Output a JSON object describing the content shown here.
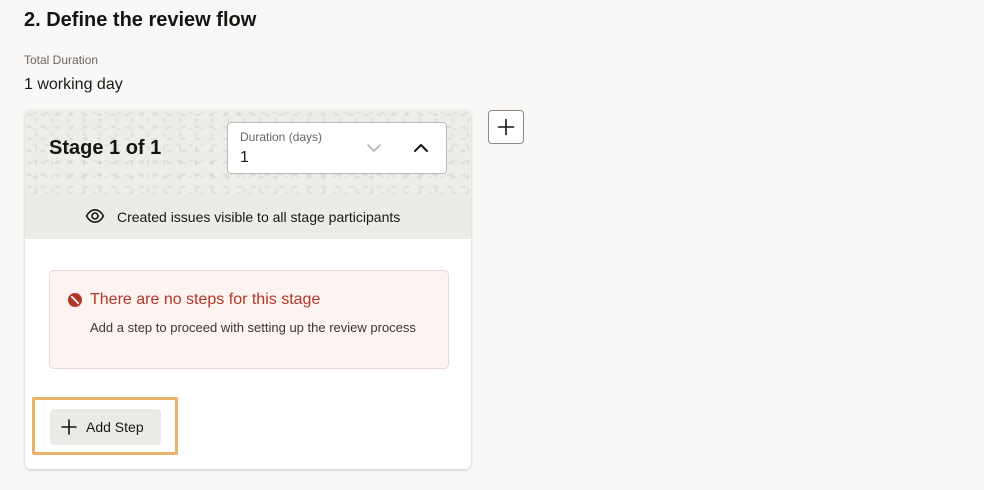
{
  "section": {
    "title": "2. Define the review flow"
  },
  "total_duration": {
    "label": "Total Duration",
    "value": "1 working day"
  },
  "stage": {
    "title": "Stage 1 of 1",
    "duration_field": {
      "label": "Duration (days)",
      "value": "1"
    },
    "visibility_text": "Created issues visible to all stage participants",
    "error": {
      "title": "There are no steps for this stage",
      "description": "Add a step to proceed with setting up the review process"
    },
    "add_step_label": "Add Step"
  },
  "icons": {
    "add_stage": "plus-icon",
    "duration_decrease": "chevron-down-icon",
    "duration_increase": "chevron-up-icon",
    "visibility": "eye-icon",
    "error": "error-circle-icon",
    "add_step": "plus-icon"
  },
  "colors": {
    "background": "#f9f8f6",
    "error_text": "#b33627",
    "error_background": "#fdf4f2",
    "highlight": "#e8b46a"
  }
}
